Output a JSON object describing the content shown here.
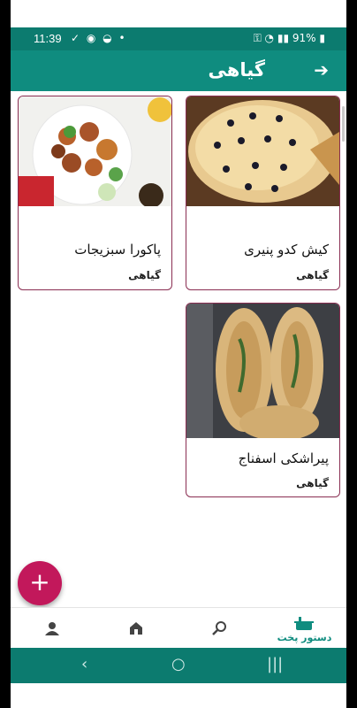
{
  "status_bar": {
    "time": "11:39",
    "battery": "91%"
  },
  "app_bar": {
    "title": "گیاهی"
  },
  "recipes": [
    {
      "name": "کیش کدو پنیری",
      "category": "گیاهی"
    },
    {
      "name": "پاکورا سبزیجات",
      "category": "گیاهی"
    },
    {
      "name": "پیراشکی اسفناج",
      "category": "گیاهی"
    }
  ],
  "fab": {
    "label": "+"
  },
  "bottom_nav": {
    "recipes_label": "دستور پخت"
  },
  "colors": {
    "primary": "#0f8c7f",
    "dark_primary": "#0c7b6f",
    "accent": "#c2185b",
    "card_border": "#8a2e52"
  }
}
